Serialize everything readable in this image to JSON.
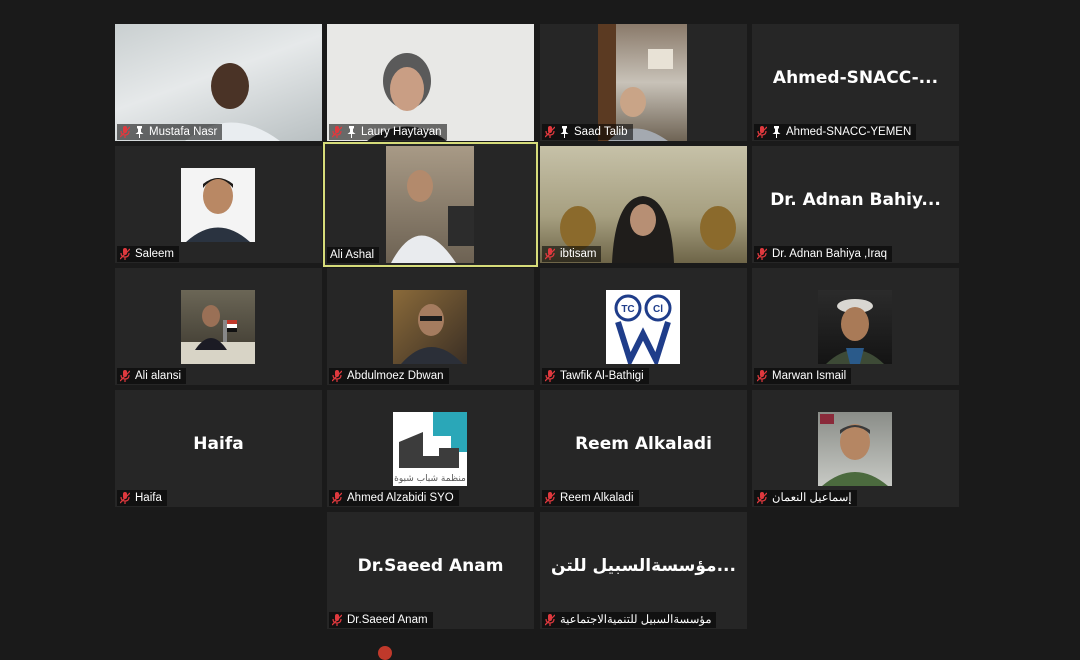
{
  "colors": {
    "background": "#1a1a1a",
    "tile": "#262626",
    "active_speaker_border": "#d6dc7a",
    "muted_mic": "#e0393e"
  },
  "tiles": [
    {
      "name": "Mustafa Nasr",
      "pinned": true,
      "muted": true
    },
    {
      "name": "Laury Haytayan",
      "pinned": true,
      "muted": true
    },
    {
      "name": "Saad Talib",
      "pinned": true,
      "muted": true
    },
    {
      "name": "Ahmed-SNACC-YEMEN",
      "big_name": "Ahmed-SNACC-...",
      "pinned": true,
      "muted": true
    },
    {
      "name": "Saleem",
      "muted": true
    },
    {
      "name": "Ali Ashal",
      "muted": false,
      "active_speaker": true
    },
    {
      "name": "ibtisam",
      "muted": true
    },
    {
      "name": "Dr. Adnan Bahiya ,Iraq",
      "big_name": "Dr. Adnan Bahiy...",
      "muted": true
    },
    {
      "name": "Ali alansi",
      "muted": true
    },
    {
      "name": "Abdulmoez Dbwan",
      "muted": true
    },
    {
      "name": "Tawfik Al-Bathigi",
      "muted": true,
      "avatar_text": "TCWII"
    },
    {
      "name": "Marwan Ismail",
      "muted": true
    },
    {
      "name": "Haifa",
      "big_name": "Haifa",
      "muted": true
    },
    {
      "name": "Ahmed Alzabidi SYO",
      "muted": true,
      "avatar_text": "منظمة شباب شبوة"
    },
    {
      "name": "Reem Alkaladi",
      "big_name": "Reem Alkaladi",
      "muted": true
    },
    {
      "name": "إسماعيل النعمان",
      "muted": true
    },
    {
      "name": "Dr.Saeed Anam",
      "big_name": "Dr.Saeed Anam",
      "muted": true
    },
    {
      "name": "مؤسسةالسبيل للتنميةالاجتماعية",
      "big_name": "مؤسسةالسبيل للتن...",
      "muted": true
    }
  ]
}
